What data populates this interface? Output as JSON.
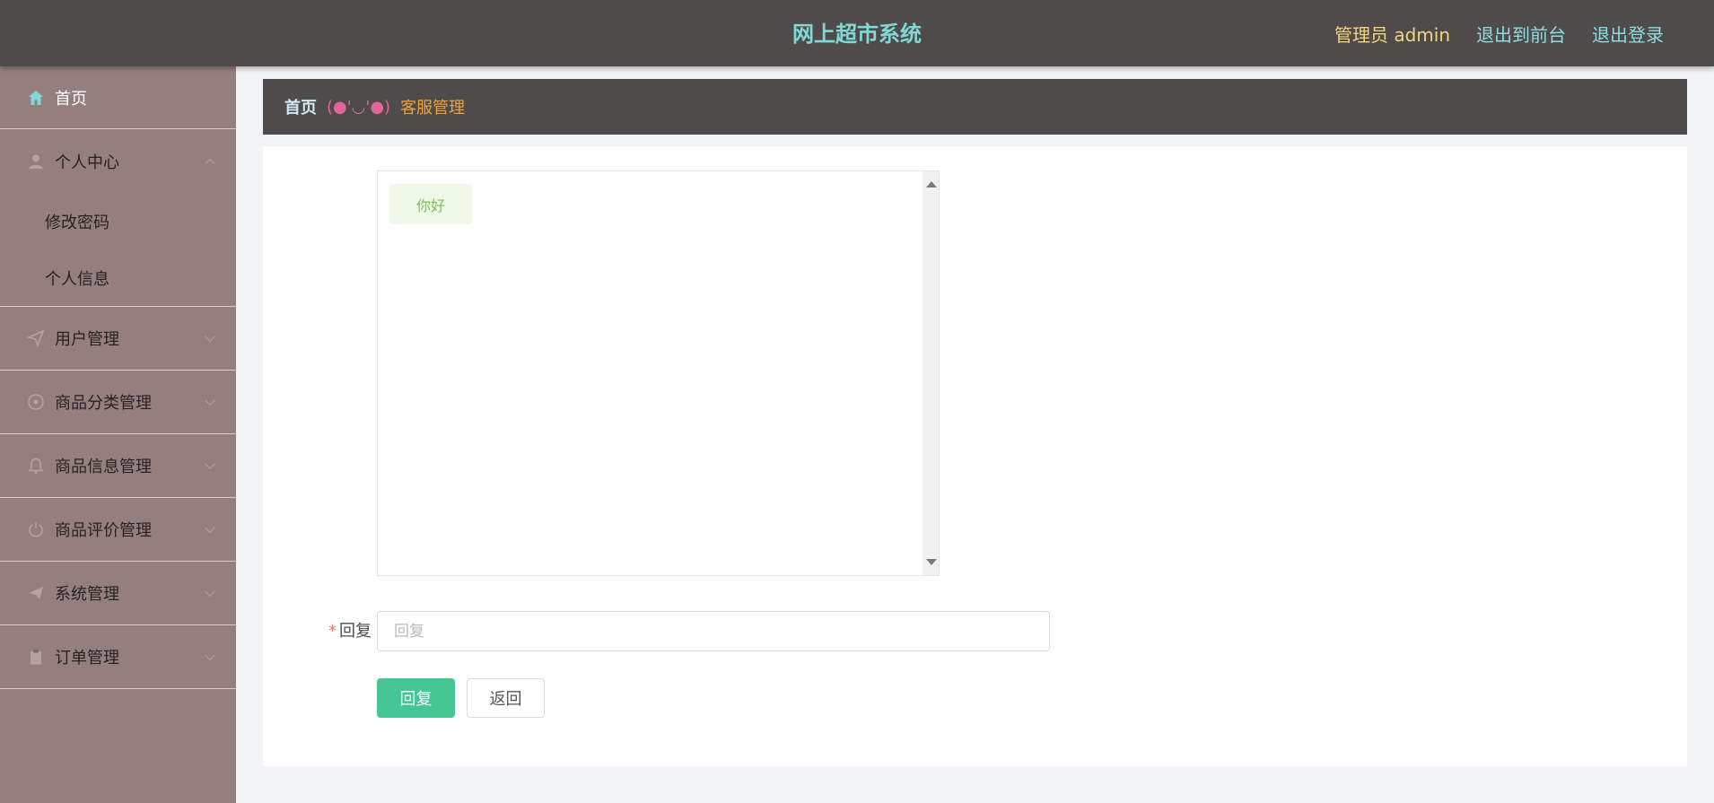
{
  "header": {
    "title": "网上超市系统",
    "admin_label": "管理员 admin",
    "to_front_label": "退出到前台",
    "logout_label": "退出登录"
  },
  "sidebar": {
    "home": {
      "label": "首页",
      "icon": "home-icon"
    },
    "personal": {
      "label": "个人中心",
      "icon": "user-icon",
      "children": [
        "修改密码",
        "个人信息"
      ]
    },
    "items": [
      {
        "label": "用户管理",
        "icon": "paper-plane-icon"
      },
      {
        "label": "商品分类管理",
        "icon": "compass-icon"
      },
      {
        "label": "商品信息管理",
        "icon": "bell-icon"
      },
      {
        "label": "商品评价管理",
        "icon": "power-icon"
      },
      {
        "label": "系统管理",
        "icon": "send-icon"
      },
      {
        "label": "订单管理",
        "icon": "clipboard-icon"
      }
    ]
  },
  "breadcrumb": {
    "home": "首页",
    "emoticon": "(●'◡'●)",
    "current": "客服管理"
  },
  "chat": {
    "messages": [
      "你好"
    ]
  },
  "form": {
    "reply_label": "回复",
    "reply_placeholder": "回复",
    "reply_value": ""
  },
  "buttons": {
    "reply": "回复",
    "back": "返回"
  },
  "colors": {
    "topbar": "#4f4b4a",
    "sidebar": "#957f7e",
    "title": "#7fd9d6",
    "primary_button": "#46c695",
    "breadcrumb_current": "#f0a03a",
    "emoticon": "#e1659a"
  }
}
